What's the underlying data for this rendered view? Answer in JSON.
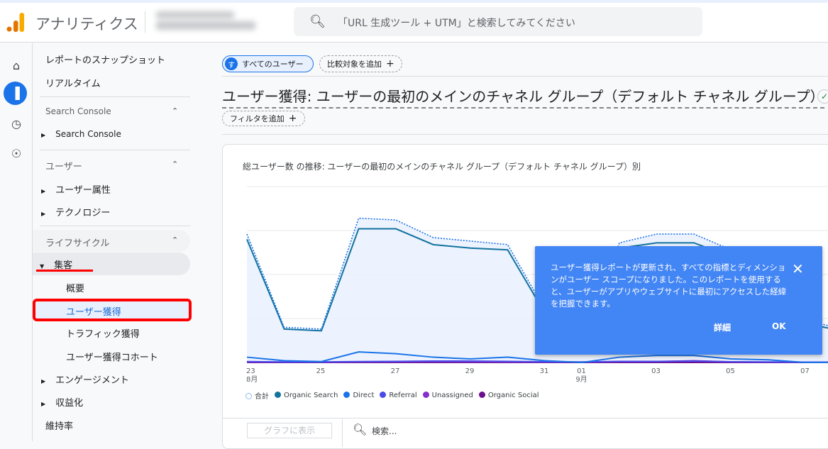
{
  "header": {
    "app_name": "アナリティクス",
    "search_placeholder": "「URL 生成ツール + UTM」と検索してみてください"
  },
  "rail": [
    {
      "icon": "home-icon"
    },
    {
      "icon": "reports-icon",
      "active": true
    },
    {
      "icon": "explore-icon"
    },
    {
      "icon": "advertising-icon"
    }
  ],
  "sidebar": {
    "top_items": [
      "レポートのスナップショット",
      "リアルタイム"
    ],
    "sections": [
      {
        "title": "Search Console",
        "items": [
          "Search Console"
        ]
      },
      {
        "title": "ユーザー",
        "items": [
          "ユーザー属性",
          "テクノロジー"
        ]
      },
      {
        "title": "ライフサイクル",
        "expanded_item": "集客",
        "sub_items": [
          "概要",
          "ユーザー獲得",
          "トラフィック獲得",
          "ユーザー獲得コホート"
        ],
        "items": [
          "エンゲージメント",
          "収益化",
          "維持率"
        ]
      }
    ],
    "selected": "ユーザー獲得"
  },
  "main": {
    "segment_chip": {
      "avatar": "す",
      "label": "すべてのユーザー"
    },
    "compare_button": "比較対象を追加",
    "title": "ユーザー獲得: ユーザーの最初のメインのチャネル グループ（デフォルト チャネル グループ）",
    "filter_button": "フィルタを追加",
    "chart_title": "総ユーザー数 の推移: ユーザーの最初のメインのチャネル グループ（デフォルト チャネル グループ）別",
    "plot_button": "グラフに表示",
    "table_search_placeholder": "検索..."
  },
  "popup": {
    "message": "ユーザー獲得レポートが更新され、すべての指標とディメンションがユーザー スコープになりました。このレポートを使用すると、ユーザーがアプリやウェブサイトに最初にアクセスした経緯を把握できます。",
    "details_button": "詳細",
    "ok_button": "OK"
  },
  "chart_data": {
    "type": "line",
    "x": [
      "8/23",
      "8/24",
      "8/25",
      "8/26",
      "8/27",
      "8/28",
      "8/29",
      "8/30",
      "8/31",
      "9/01",
      "9/02",
      "9/03",
      "9/04",
      "9/05",
      "9/06",
      "9/07",
      "9/08"
    ],
    "x_tick_labels": [
      {
        "day": "23",
        "month": "8月"
      },
      {
        "day": "25"
      },
      {
        "day": "27"
      },
      {
        "day": "29"
      },
      {
        "day": "31"
      },
      {
        "day": "01",
        "month": "9月"
      },
      {
        "day": "03"
      },
      {
        "day": "05"
      },
      {
        "day": "07"
      }
    ],
    "grid": true,
    "legend_placement": "bottom-left",
    "series": [
      {
        "name": "合計",
        "color": "#1a73e8",
        "style": "dotted",
        "values": [
          73,
          20,
          19,
          82,
          81,
          71,
          69,
          67,
          30,
          13,
          68,
          73,
          73,
          64,
          43,
          24,
          19
        ]
      },
      {
        "name": "Organic Search",
        "color": "#12739e",
        "values": [
          70,
          19,
          18,
          76,
          76,
          67,
          65,
          64,
          28,
          12,
          65,
          68,
          68,
          60,
          40,
          22,
          18
        ]
      },
      {
        "name": "Direct",
        "color": "#1a73e8",
        "values": [
          3,
          1,
          0.5,
          6,
          5,
          3,
          2,
          3,
          1,
          0,
          3,
          4,
          4,
          2,
          1.5,
          0,
          0
        ]
      },
      {
        "name": "Referral",
        "color": "#4a4ae8",
        "values": [
          0.5,
          0.3,
          0.3,
          0.5,
          0.6,
          0.8,
          0.8,
          0.6,
          0.4,
          0.3,
          0.6,
          0.6,
          0.8,
          0.4,
          0.3,
          0.2,
          0.2
        ]
      },
      {
        "name": "Unassigned",
        "color": "#8430ce",
        "values": [
          0.3,
          0.2,
          0.2,
          0.3,
          0.4,
          0.5,
          0.4,
          0.3,
          0.2,
          0.2,
          0.5,
          0.5,
          1,
          0.3,
          0.2,
          0.1,
          0.1
        ]
      },
      {
        "name": "Organic Social",
        "color": "#6a0f8e",
        "values": [
          0,
          0,
          0,
          0,
          0,
          0,
          0,
          0,
          0,
          0,
          0,
          0,
          0,
          0,
          0,
          0,
          0
        ]
      }
    ]
  }
}
